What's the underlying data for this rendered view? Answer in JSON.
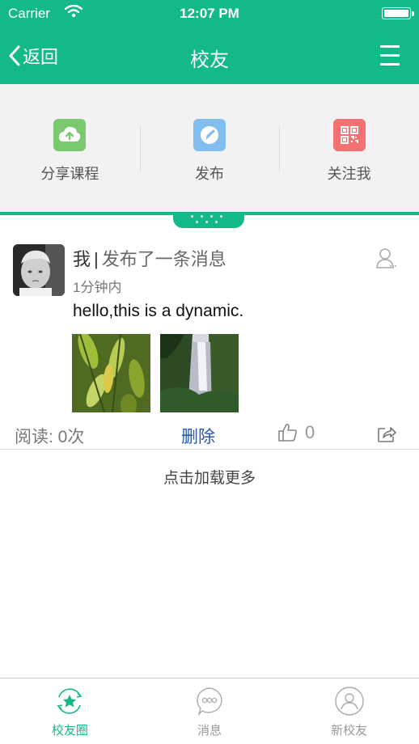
{
  "status_bar": {
    "carrier": "Carrier",
    "time": "12:07 PM"
  },
  "nav": {
    "back_label": "返回",
    "title": "校友"
  },
  "actions": [
    {
      "label": "分享课程",
      "icon": "upload-cloud-icon",
      "color": "#7bc96f"
    },
    {
      "label": "发布",
      "icon": "edit-pen-icon",
      "color": "#82bdf0"
    },
    {
      "label": "关注我",
      "icon": "qr-code-icon",
      "color": "#f57070"
    }
  ],
  "post": {
    "author": "我",
    "action": "发布了一条消息",
    "time_ago": "1分钟内",
    "text": "hello,this is a dynamic.",
    "reads": "阅读: 0次",
    "delete_label": "删除",
    "likes": "0"
  },
  "load_more": "点击加载更多",
  "tabbar": {
    "items": [
      {
        "label": "校友圈",
        "active": true
      },
      {
        "label": "消息",
        "active": false
      },
      {
        "label": "新校友",
        "active": false
      }
    ]
  },
  "colors": {
    "brand": "#14b98a",
    "link": "#2a56a8"
  }
}
